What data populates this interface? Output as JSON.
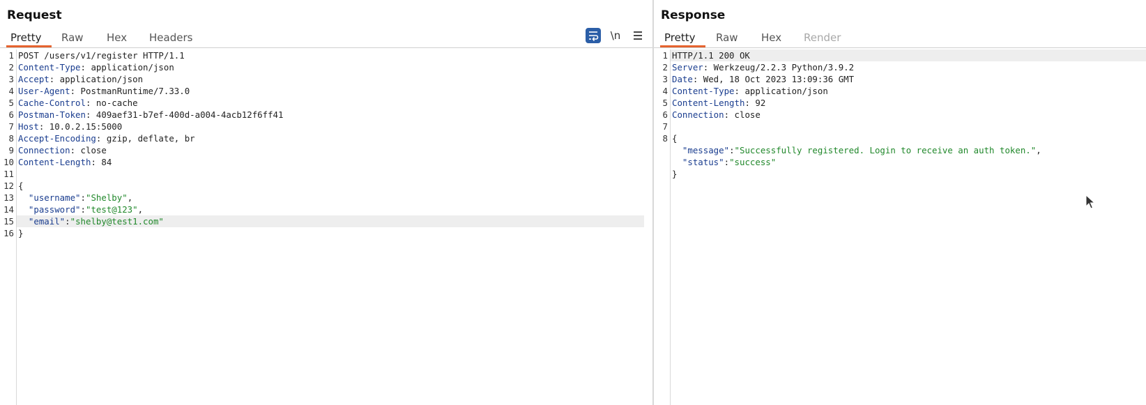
{
  "request": {
    "title": "Request",
    "tabs": [
      "Pretty",
      "Raw",
      "Hex",
      "Headers"
    ],
    "active_tab": "Pretty",
    "toolbar": {
      "wrap_icon": "wrap-text-icon",
      "newline_label": "\\n",
      "menu_icon": "hamburger-menu-icon"
    },
    "lines": [
      {
        "n": "1",
        "parts": [
          {
            "t": "POST /users/v1/register HTTP/1.1",
            "c": ""
          }
        ]
      },
      {
        "n": "2",
        "parts": [
          {
            "t": "Content-Type",
            "c": "hk"
          },
          {
            "t": ": application/json",
            "c": ""
          }
        ]
      },
      {
        "n": "3",
        "parts": [
          {
            "t": "Accept",
            "c": "hk"
          },
          {
            "t": ": application/json",
            "c": ""
          }
        ]
      },
      {
        "n": "4",
        "parts": [
          {
            "t": "User-Agent",
            "c": "hk"
          },
          {
            "t": ": PostmanRuntime/7.33.0",
            "c": ""
          }
        ]
      },
      {
        "n": "5",
        "parts": [
          {
            "t": "Cache-Control",
            "c": "hk"
          },
          {
            "t": ": no-cache",
            "c": ""
          }
        ]
      },
      {
        "n": "6",
        "parts": [
          {
            "t": "Postman-Token",
            "c": "hk"
          },
          {
            "t": ": 409aef31-b7ef-400d-a004-4acb12f6ff41",
            "c": ""
          }
        ]
      },
      {
        "n": "7",
        "parts": [
          {
            "t": "Host",
            "c": "hk"
          },
          {
            "t": ": 10.0.2.15:5000",
            "c": ""
          }
        ]
      },
      {
        "n": "8",
        "parts": [
          {
            "t": "Accept-Encoding",
            "c": "hk"
          },
          {
            "t": ": gzip, deflate, br",
            "c": ""
          }
        ]
      },
      {
        "n": "9",
        "parts": [
          {
            "t": "Connection",
            "c": "hk"
          },
          {
            "t": ": close",
            "c": ""
          }
        ]
      },
      {
        "n": "10",
        "parts": [
          {
            "t": "Content-Length",
            "c": "hk"
          },
          {
            "t": ": 84",
            "c": ""
          }
        ]
      },
      {
        "n": "11",
        "parts": []
      },
      {
        "n": "12",
        "parts": [
          {
            "t": "{",
            "c": ""
          }
        ]
      },
      {
        "n": "13",
        "parts": [
          {
            "t": "  \"username\"",
            "c": "jk"
          },
          {
            "t": ":",
            "c": ""
          },
          {
            "t": "\"Shelby\"",
            "c": "js"
          },
          {
            "t": ",",
            "c": ""
          }
        ]
      },
      {
        "n": "14",
        "parts": [
          {
            "t": "  \"password\"",
            "c": "jk"
          },
          {
            "t": ":",
            "c": ""
          },
          {
            "t": "\"test@123\"",
            "c": "js"
          },
          {
            "t": ",",
            "c": ""
          }
        ]
      },
      {
        "n": "15",
        "hl": true,
        "parts": [
          {
            "t": "  \"email\"",
            "c": "jk"
          },
          {
            "t": ":",
            "c": ""
          },
          {
            "t": "\"shelby@test1.com\"",
            "c": "js"
          }
        ]
      },
      {
        "n": "16",
        "parts": [
          {
            "t": "}",
            "c": ""
          }
        ]
      }
    ]
  },
  "response": {
    "title": "Response",
    "tabs": [
      "Pretty",
      "Raw",
      "Hex",
      "Render"
    ],
    "active_tab": "Pretty",
    "disabled_tabs": [
      "Render"
    ],
    "lines": [
      {
        "n": "1",
        "hl": true,
        "parts": [
          {
            "t": "HTTP/1.1 200 OK",
            "c": ""
          }
        ]
      },
      {
        "n": "2",
        "parts": [
          {
            "t": "Server",
            "c": "hk"
          },
          {
            "t": ": Werkzeug/2.2.3 Python/3.9.2",
            "c": ""
          }
        ]
      },
      {
        "n": "3",
        "parts": [
          {
            "t": "Date",
            "c": "hk"
          },
          {
            "t": ": Wed, 18 Oct 2023 13:09:36 GMT",
            "c": ""
          }
        ]
      },
      {
        "n": "4",
        "parts": [
          {
            "t": "Content-Type",
            "c": "hk"
          },
          {
            "t": ": application/json",
            "c": ""
          }
        ]
      },
      {
        "n": "5",
        "parts": [
          {
            "t": "Content-Length",
            "c": "hk"
          },
          {
            "t": ": 92",
            "c": ""
          }
        ]
      },
      {
        "n": "6",
        "parts": [
          {
            "t": "Connection",
            "c": "hk"
          },
          {
            "t": ": close",
            "c": ""
          }
        ]
      },
      {
        "n": "7",
        "parts": []
      },
      {
        "n": "8",
        "parts": [
          {
            "t": "{",
            "c": ""
          }
        ]
      },
      {
        "n": "",
        "parts": [
          {
            "t": "  \"message\"",
            "c": "jk"
          },
          {
            "t": ":",
            "c": ""
          },
          {
            "t": "\"Successfully registered. Login to receive an auth token.\"",
            "c": "js"
          },
          {
            "t": ",",
            "c": ""
          }
        ]
      },
      {
        "n": "",
        "parts": [
          {
            "t": "  \"status\"",
            "c": "jk"
          },
          {
            "t": ":",
            "c": ""
          },
          {
            "t": "\"success\"",
            "c": "js"
          }
        ]
      },
      {
        "n": "",
        "parts": [
          {
            "t": "}",
            "c": ""
          }
        ]
      }
    ]
  },
  "colors": {
    "accent": "#e5632f",
    "header_key": "#1a3d8f",
    "json_string": "#21882b",
    "wrap_button": "#2b5ea7"
  }
}
